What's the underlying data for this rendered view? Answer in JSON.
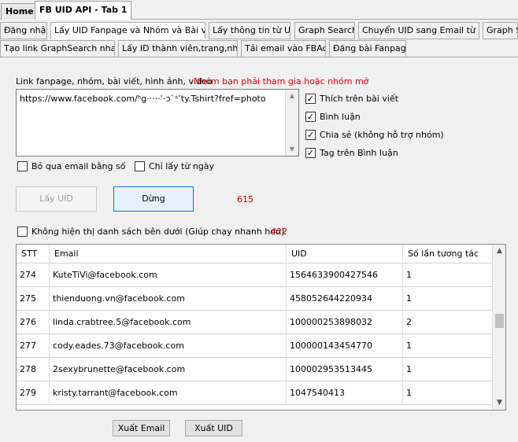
{
  "top_tabs": [
    {
      "label": "Home",
      "active": false
    },
    {
      "label": "FB UID API - Tab 1",
      "active": true
    }
  ],
  "sub_tabs_row1": [
    {
      "label": "Đăng nhập"
    },
    {
      "label": "Lấy UID Fanpage và Nhóm và Bài viết",
      "active": true
    },
    {
      "label": "Lấy thông tin từ UID"
    },
    {
      "label": "Graph Search"
    },
    {
      "label": "Chuyển UID sang Email từ File"
    },
    {
      "label": "Graph S"
    }
  ],
  "sub_tabs_row2": [
    {
      "label": "Tạo link GraphSearch nhanh"
    },
    {
      "label": "Lấy ID thành viên,trang,nhóm"
    },
    {
      "label": "Tải email vào FBAds"
    },
    {
      "label": "Đăng bài Fanpage"
    }
  ],
  "form": {
    "input_label": "Link fanpage, nhóm, bài viết, hình ảnh, video",
    "input_note": "Nhóm bạn phải tham gia hoặc nhóm mở",
    "input_value": "https://www.facebook.com/ʰg·····ʿ·ɔ`ˢʼty.Tshirt?fref=photo",
    "options": [
      {
        "label": "Thích trên bài viết",
        "checked": true
      },
      {
        "label": "Bình luận",
        "checked": true
      },
      {
        "label": "Chia sẻ (không hỗ trợ nhóm)",
        "checked": true
      },
      {
        "label": "Tag trên Bình luận",
        "checked": true
      }
    ],
    "skip_email": {
      "label": "Bỏ qua email bằng số",
      "checked": false
    },
    "today_only": {
      "label": "Chỉ lấy từ ngày",
      "checked": false
    },
    "btn_get": "Lấy UID",
    "btn_stop": "Dừng",
    "count": "615",
    "hide_list": {
      "label": "Không hiện thị danh sách bên dưới (Giúp chạy nhanh hơn)",
      "checked": false
    },
    "count2": "422"
  },
  "table": {
    "columns": [
      "STT",
      "Email",
      "UID",
      "Số lần tương tác"
    ],
    "rows": [
      [
        "274",
        "KuteTiVi@facebook.com",
        "1564633900427546",
        "1"
      ],
      [
        "275",
        "thienduong.vn@facebook.com",
        "458052644220934",
        "1"
      ],
      [
        "276",
        "linda.crabtree.5@facebook.com",
        "100000253898032",
        "2"
      ],
      [
        "277",
        "cody.eades.73@facebook.com",
        "100000143454770",
        "1"
      ],
      [
        "278",
        "2sexybrunette@facebook.com",
        "100002953513445",
        "1"
      ],
      [
        "279",
        "kristy.tarrant@facebook.com",
        "1047540413",
        "1"
      ]
    ]
  },
  "footer": {
    "btn_export_email": "Xuất Email",
    "btn_export_uid": "Xuất UID"
  },
  "icons": {
    "checkmark": "✓",
    "scroll_up": "▲",
    "scroll_down": "▼"
  }
}
